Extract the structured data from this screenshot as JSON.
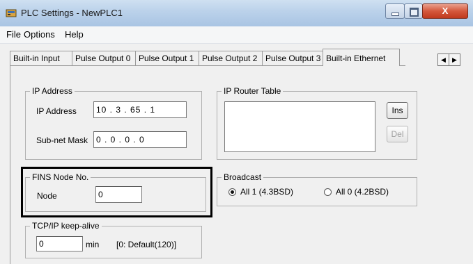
{
  "window": {
    "title": "PLC Settings - NewPLC1",
    "close_glyph": "X",
    "icons": [
      "app-icon",
      "minimize-icon",
      "maximize-icon",
      "close-icon"
    ]
  },
  "menu": [
    "File",
    "Options",
    "Help"
  ],
  "tabs": [
    {
      "label": "Built-in Input",
      "active": false
    },
    {
      "label": "Pulse Output 0",
      "active": false
    },
    {
      "label": "Pulse Output 1",
      "active": false
    },
    {
      "label": "Pulse Output 2",
      "active": false
    },
    {
      "label": "Pulse Output 3",
      "active": false
    },
    {
      "label": "Built-in Ethernet",
      "active": true
    }
  ],
  "tab_scroll": {
    "left": "◀",
    "right": "▶"
  },
  "ip_address_group": {
    "title": "IP Address",
    "ip_label": "IP Address",
    "ip_value": "10 .  3  .  65  .  1",
    "mask_label": "Sub-net Mask",
    "mask_value": "0  .  0  .  0  .  0"
  },
  "router_table_group": {
    "title": "IP Router Table",
    "ins_label": "Ins",
    "del_label": "Del"
  },
  "fins_group": {
    "title": "FINS Node No.",
    "node_label": "Node",
    "node_value": "0"
  },
  "broadcast_group": {
    "title": "Broadcast",
    "option1": "All 1 (4.3BSD)",
    "option2": "All 0 (4.2BSD)",
    "selected": "All 1 (4.3BSD)"
  },
  "keepalive_group": {
    "title": "TCP/IP keep-alive",
    "value": "0",
    "unit": "min",
    "hint": "[0: Default(120)]"
  },
  "colors": {
    "titlebar": "#bad1ea",
    "close_button": "#c0391d",
    "highlight": "#000000"
  }
}
